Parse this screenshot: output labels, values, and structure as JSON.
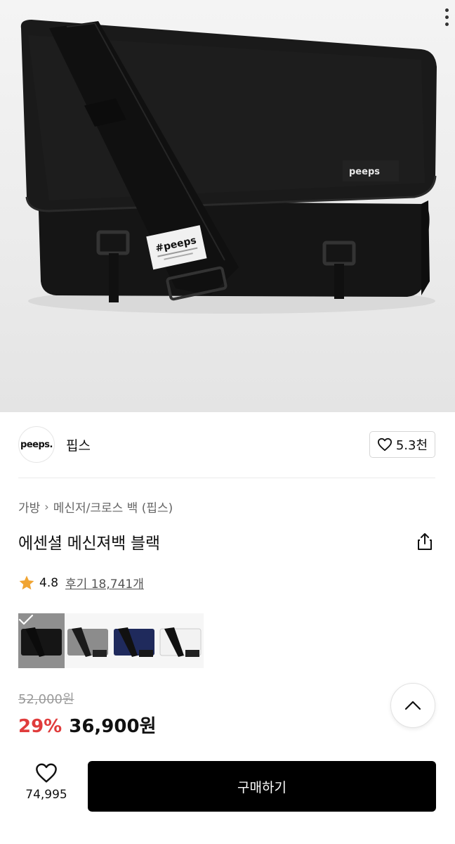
{
  "hero": {
    "image": "black-messenger-bag-photo",
    "bag_logo_text": "peeps",
    "strap_label_text": "#peeps"
  },
  "brand": {
    "logo_text": "peeps.",
    "name": "핍스",
    "like_count": "5.3천"
  },
  "breadcrumb": {
    "category": "가방",
    "subcategory": "메신저/크로스 백 (핍스)"
  },
  "product": {
    "title": "에센셜 메신져백 블랙"
  },
  "rating": {
    "score": "4.8",
    "reviews": "후기 18,741개",
    "star_color": "#f0a432"
  },
  "colors": [
    {
      "name": "black",
      "swatch": "#111111",
      "selected": true
    },
    {
      "name": "gray",
      "swatch": "#8c8c8c",
      "selected": false
    },
    {
      "name": "navy",
      "swatch": "#1f2a5c",
      "selected": false
    },
    {
      "name": "white",
      "swatch": "#f2f2f2",
      "selected": false
    }
  ],
  "price": {
    "original": "52,000원",
    "discount": "29%",
    "sale": "36,900원",
    "discount_color": "#e03c3c"
  },
  "bottom_bar": {
    "wish_count": "74,995",
    "buy_label": "구매하기"
  },
  "icons": {
    "more": "more-vertical-icon",
    "heart": "heart-icon",
    "share": "share-icon",
    "star": "star-icon",
    "chevron_up": "chevron-up-icon"
  }
}
